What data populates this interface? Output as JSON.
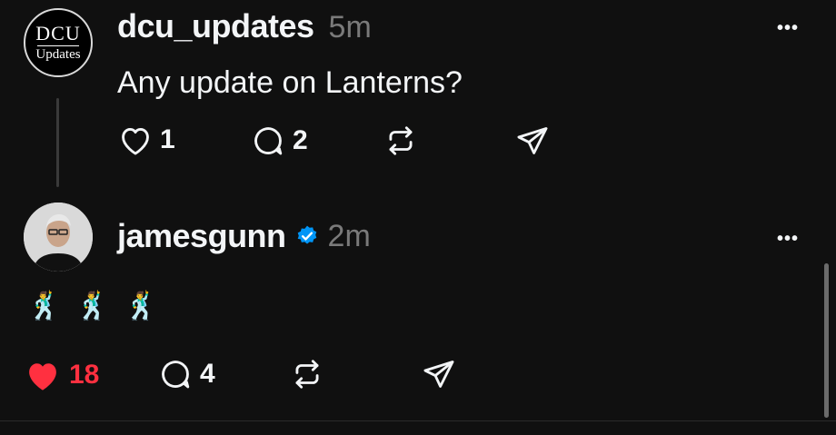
{
  "posts": [
    {
      "username": "dcu_updates",
      "time": "5m",
      "text": "Any update on Lanterns?",
      "avatar_text": {
        "top": "DCU",
        "bottom": "Updates"
      },
      "likes": "1",
      "replies": "2",
      "liked": false
    },
    {
      "username": "jamesgunn",
      "time": "2m",
      "verified": true,
      "emoji": "🕺🕺🕺",
      "likes": "18",
      "replies": "4",
      "liked": true
    }
  ],
  "more_label": "•••",
  "colors": {
    "background": "#101010",
    "like_active": "#ff3040",
    "verified": "#0095f6",
    "secondary_text": "#7a7a7a"
  },
  "icons": [
    "heart-icon",
    "comment-icon",
    "repost-icon",
    "share-icon",
    "verified-badge-icon",
    "more-icon"
  ]
}
